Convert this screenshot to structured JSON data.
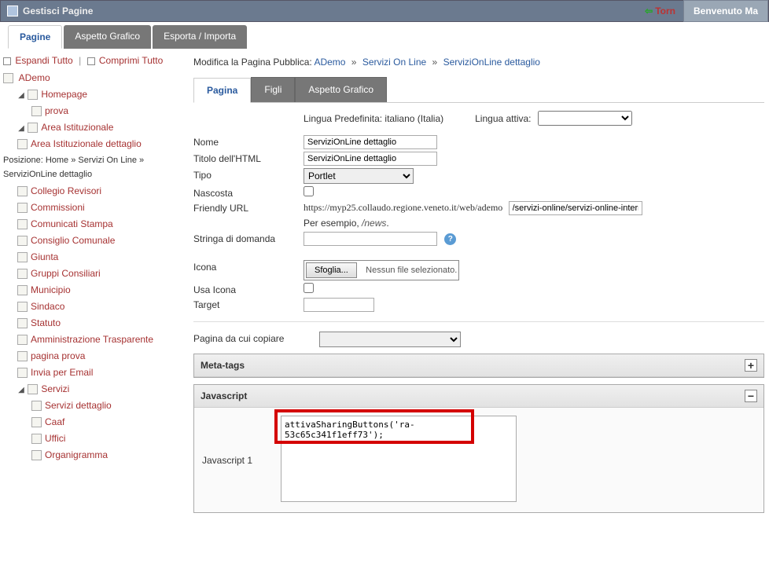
{
  "header": {
    "title": "Gestisci Pagine",
    "torna": "Torn",
    "welcome": "Benvenuto Ma"
  },
  "mainTabs": [
    {
      "label": "Pagine",
      "active": true
    },
    {
      "label": "Aspetto Grafico",
      "active": false
    },
    {
      "label": "Esporta / Importa",
      "active": false
    }
  ],
  "sidebarActions": {
    "expand": "Espandi Tutto",
    "collapse": "Comprimi Tutto"
  },
  "treeRoot": "ADemo",
  "tree": {
    "homepage": "Homepage",
    "prova": "prova",
    "areaIst": "Area Istituzionale",
    "areaIstDett": "Area Istituzionale dettaglio",
    "posizione_label": "Posizione:",
    "posizione": "Home » Servizi On Line » ServiziOnLine dettaglio",
    "collegio": "Collegio Revisori",
    "commissioni": "Commissioni",
    "comunicati": "Comunicati Stampa",
    "consiglio": "Consiglio Comunale",
    "giunta": "Giunta",
    "gruppi": "Gruppi Consiliari",
    "municipio": "Municipio",
    "sindaco": "Sindaco",
    "statuto": "Statuto",
    "ammTrasp": "Amministrazione Trasparente",
    "paginaProva": "pagina prova",
    "inviaEmail": "Invia per Email",
    "servizi": "Servizi",
    "serviziDett": "Servizi dettaglio",
    "caaf": "Caaf",
    "uffici": "Uffici",
    "organigramma": "Organigramma"
  },
  "breadcrumb": {
    "prefix": "Modifica la Pagina Pubblica:",
    "p1": "ADemo",
    "p2": "Servizi On Line",
    "p3": "ServiziOnLine dettaglio"
  },
  "subTabs": [
    {
      "label": "Pagina",
      "active": true
    },
    {
      "label": "Figli",
      "active": false
    },
    {
      "label": "Aspetto Grafico",
      "active": false
    }
  ],
  "lang": {
    "default_label": "Lingua Predefinita:",
    "default_value": "italiano (Italia)",
    "active_label": "Lingua attiva:"
  },
  "form": {
    "nome_label": "Nome",
    "nome_value": "ServiziOnLine dettaglio",
    "titolo_label": "Titolo dell'HTML",
    "titolo_value": "ServiziOnLine dettaglio",
    "tipo_label": "Tipo",
    "tipo_value": "Portlet",
    "nascosta_label": "Nascosta",
    "friendly_label": "Friendly URL",
    "friendly_prefix": "https://myp25.collaudo.regione.veneto.it/web/ademo",
    "friendly_value": "/servizi-online/servizi-online-interna",
    "esempio_prefix": "Per esempio, ",
    "esempio_italic": "/news",
    "stringa_label": "Stringa di domanda",
    "icona_label": "Icona",
    "sfoglia_btn": "Sfoglia...",
    "file_status": "Nessun file selezionato.",
    "usaicona_label": "Usa Icona",
    "target_label": "Target",
    "copia_label": "Pagina da cui copiare"
  },
  "panels": {
    "meta": "Meta-tags",
    "js": "Javascript",
    "js1_label": "Javascript 1",
    "js1_value": "attivaSharingButtons('ra-53c65c341f1eff73');"
  }
}
